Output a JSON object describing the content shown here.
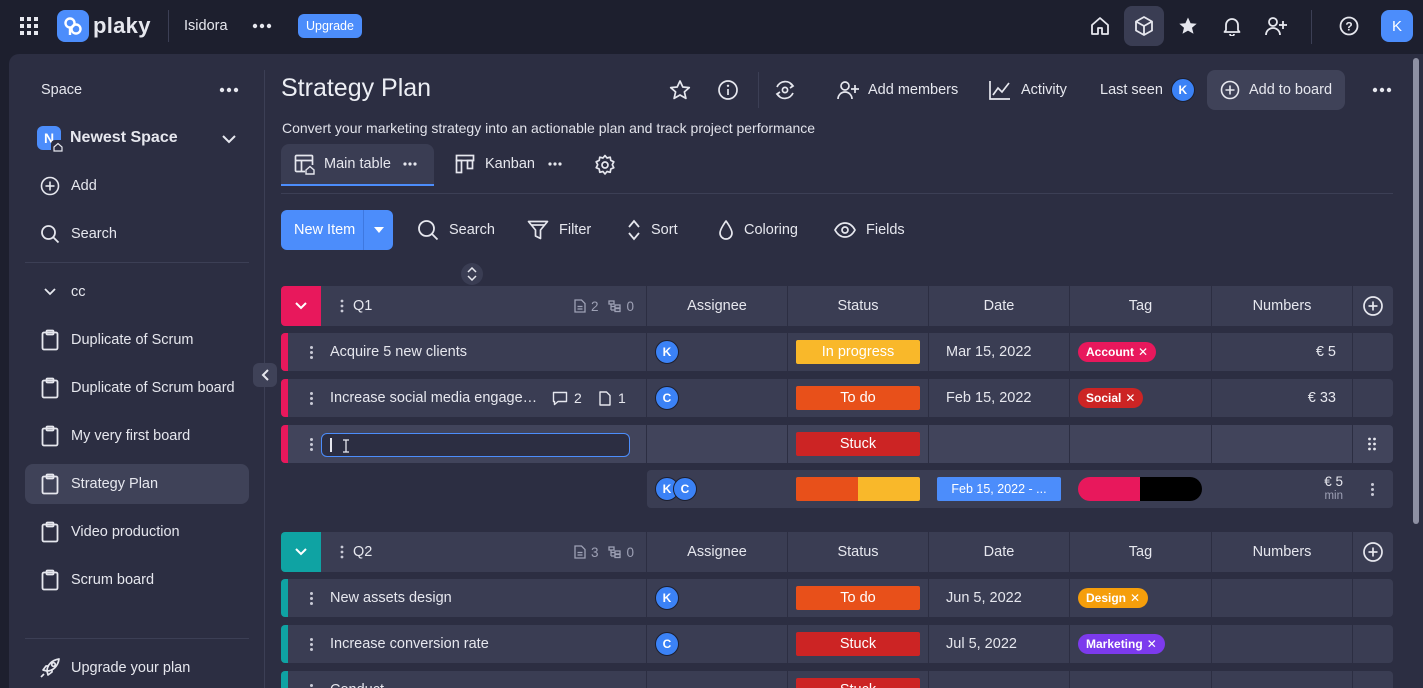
{
  "topbar": {
    "logo_text": "plaky",
    "workspace": "Isidora",
    "upgrade_label": "Upgrade",
    "user_initial": "K"
  },
  "sidebar": {
    "space_label": "Space",
    "space_name": "Newest Space",
    "space_initial": "N",
    "add_label": "Add",
    "search_label": "Search",
    "folder_label": "cc",
    "boards": [
      {
        "label": "Duplicate of Scrum"
      },
      {
        "label": "Duplicate of Scrum board"
      },
      {
        "label": "My very first board"
      },
      {
        "label": "Strategy Plan"
      },
      {
        "label": "Video production"
      },
      {
        "label": "Scrum board"
      }
    ],
    "active_board": "Strategy Plan",
    "upgrade_plan_label": "Upgrade your plan"
  },
  "board": {
    "title": "Strategy Plan",
    "description": "Convert your marketing strategy into an actionable plan and track project performance",
    "add_members_label": "Add members",
    "activity_label": "Activity",
    "last_seen_label": "Last seen",
    "last_seen_initial": "K",
    "add_to_board_label": "Add to board",
    "views": [
      {
        "label": "Main table"
      },
      {
        "label": "Kanban"
      }
    ]
  },
  "toolbar": {
    "new_item_label": "New Item",
    "search_label": "Search",
    "filter_label": "Filter",
    "sort_label": "Sort",
    "coloring_label": "Coloring",
    "fields_label": "Fields"
  },
  "columns": {
    "assignee": "Assignee",
    "status": "Status",
    "date": "Date",
    "tag": "Tag",
    "numbers": "Numbers"
  },
  "colors": {
    "q1_accent": "#e8185c",
    "q2_accent": "#0fa3a3",
    "in_progress": "#f9b82a",
    "to_do": "#e8501a",
    "stuck": "#cc2424",
    "brand_blue": "#4c8dfb"
  },
  "groups": [
    {
      "name": "Q1",
      "item_count": "2",
      "subitem_count": "0",
      "rows": [
        {
          "name": "Acquire 5 new clients",
          "assignee": "K",
          "status": "In progress",
          "date": "Mar 15, 2022",
          "tag": "Account",
          "number": "€ 5"
        },
        {
          "name": "Increase social media engage…",
          "comments": "2",
          "files": "1",
          "assignee": "C",
          "status": "To do",
          "date": "Feb 15, 2022",
          "tag": "Social",
          "number": "€ 33"
        },
        {
          "name": "",
          "assignee": "",
          "status": "Stuck",
          "date": "",
          "tag": "",
          "number": ""
        }
      ],
      "summary": {
        "assignees": [
          "K",
          "C"
        ],
        "date_range": "Feb 15, 2022 - ...",
        "number": "€ 5",
        "number_caption": "min",
        "status_split": [
          0.5,
          0.5
        ],
        "tag_split": [
          0.5,
          0.5
        ]
      }
    },
    {
      "name": "Q2",
      "item_count": "3",
      "subitem_count": "0",
      "rows": [
        {
          "name": "New assets design",
          "assignee": "K",
          "status": "To do",
          "date": "Jun 5, 2022",
          "tag": "Design",
          "number": ""
        },
        {
          "name": "Increase conversion rate",
          "assignee": "C",
          "status": "Stuck",
          "date": "Jul 5, 2022",
          "tag": "Marketing",
          "number": ""
        },
        {
          "name": "Conduct…",
          "assignee": "",
          "status": "Stuck",
          "date": "",
          "tag": "",
          "number": ""
        }
      ]
    }
  ]
}
